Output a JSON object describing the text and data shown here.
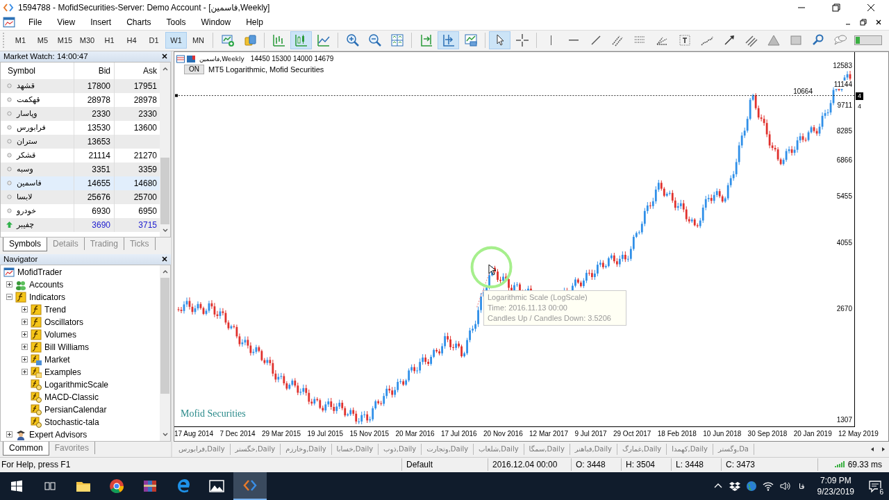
{
  "window": {
    "title": "1594788 - MofidSecurities-Server: Demo Account - [فاسمین,Weekly]"
  },
  "menu": [
    "File",
    "View",
    "Insert",
    "Charts",
    "Tools",
    "Window",
    "Help"
  ],
  "toolbar": {
    "timeframes": [
      {
        "label": "M1",
        "selected": false
      },
      {
        "label": "M5",
        "selected": false
      },
      {
        "label": "M15",
        "selected": false
      },
      {
        "label": "M30",
        "selected": false
      },
      {
        "label": "H1",
        "selected": false
      },
      {
        "label": "H4",
        "selected": false
      },
      {
        "label": "D1",
        "selected": false
      },
      {
        "label": "W1",
        "selected": true
      },
      {
        "label": "MN",
        "selected": false
      }
    ],
    "tools": [
      {
        "kind": "new-chart",
        "selected": false
      },
      {
        "kind": "profiles",
        "selected": false
      },
      {
        "kind": "bars",
        "selected": false
      },
      {
        "kind": "candles",
        "selected": true
      },
      {
        "kind": "line-chart",
        "selected": false
      },
      {
        "kind": "zoom-in",
        "selected": false
      },
      {
        "kind": "zoom-out",
        "selected": false
      },
      {
        "kind": "tile",
        "selected": false
      },
      {
        "kind": "chart-shift",
        "selected": false
      },
      {
        "kind": "autoscroll",
        "selected": true
      },
      {
        "kind": "template",
        "selected": false
      },
      {
        "kind": "cursor",
        "selected": true
      },
      {
        "kind": "crosshair",
        "selected": false
      },
      {
        "kind": "vertical-line",
        "selected": false
      },
      {
        "kind": "horizontal-line",
        "selected": false
      },
      {
        "kind": "trend-line",
        "selected": false
      },
      {
        "kind": "channel",
        "selected": false
      },
      {
        "kind": "grid",
        "selected": false
      },
      {
        "kind": "fan",
        "selected": false
      },
      {
        "kind": "text-box",
        "selected": false
      },
      {
        "kind": "staircase",
        "selected": false
      },
      {
        "kind": "arrow",
        "selected": false
      },
      {
        "kind": "parallel-lines",
        "selected": false
      },
      {
        "kind": "triangle",
        "selected": false
      },
      {
        "kind": "rectangle",
        "selected": false
      },
      {
        "kind": "search",
        "selected": false
      },
      {
        "kind": "chat",
        "selected": false
      }
    ]
  },
  "market_watch": {
    "title": "Market Watch: 14:00:47",
    "columns": [
      "Symbol",
      "Bid",
      "Ask"
    ],
    "rows": [
      {
        "symbol": "قشهد",
        "bid": "17800",
        "ask": "17951",
        "selected": false,
        "kind": "tick"
      },
      {
        "symbol": "قهکمت",
        "bid": "28978",
        "ask": "28978",
        "selected": false,
        "kind": "tick"
      },
      {
        "symbol": "وپاسار",
        "bid": "2330",
        "ask": "2330",
        "selected": false,
        "kind": "tick"
      },
      {
        "symbol": "فرابورس",
        "bid": "13530",
        "ask": "13600",
        "selected": false,
        "kind": "tick"
      },
      {
        "symbol": "ستران",
        "bid": "13653",
        "selected": false,
        "kind": "tick"
      },
      {
        "symbol": "قشکر",
        "bid": "21114",
        "ask": "21270",
        "selected": false,
        "kind": "tick"
      },
      {
        "symbol": "وسبه",
        "bid": "3351",
        "ask": "3359",
        "selected": false,
        "kind": "tick"
      },
      {
        "symbol": "فاسمین",
        "bid": "14655",
        "ask": "14680",
        "selected": true,
        "kind": "tick"
      },
      {
        "symbol": "لابسا",
        "bid": "25676",
        "ask": "25700",
        "selected": false,
        "kind": "tick"
      },
      {
        "symbol": "خودرو",
        "bid": "6930",
        "ask": "6950",
        "selected": false,
        "kind": "tick"
      },
      {
        "symbol": "چفیبر",
        "bid": "3690",
        "ask": "3715",
        "selected": false,
        "kind": "up"
      }
    ],
    "tabs": [
      {
        "label": "Symbols",
        "selected": true
      },
      {
        "label": "Details",
        "selected": false
      },
      {
        "label": "Trading",
        "selected": false
      },
      {
        "label": "Ticks",
        "selected": false
      }
    ]
  },
  "navigator": {
    "title": "Navigator",
    "tree": [
      {
        "label": "MofidTrader",
        "kind": "terminal",
        "children": [
          {
            "label": "Accounts",
            "kind": "accounts",
            "expanded": false
          },
          {
            "label": "Indicators",
            "kind": "folder",
            "expanded": true,
            "children": [
              {
                "label": "Trend",
                "kind": "folder",
                "expanded": false
              },
              {
                "label": "Oscillators",
                "kind": "folder",
                "expanded": false
              },
              {
                "label": "Volumes",
                "kind": "folder",
                "expanded": false
              },
              {
                "label": "Bill Williams",
                "kind": "folder",
                "expanded": false
              },
              {
                "label": "Market",
                "kind": "market",
                "expanded": false
              },
              {
                "label": "Examples",
                "kind": "examples",
                "expanded": false
              },
              {
                "label": "LogarithmicScale",
                "kind": "indicator"
              },
              {
                "label": "MACD-Classic",
                "kind": "indicator"
              },
              {
                "label": "PersianCalendar",
                "kind": "indicator"
              },
              {
                "label": "Stochastic-tala",
                "kind": "indicator"
              }
            ]
          },
          {
            "label": "Expert Advisors",
            "kind": "experts",
            "expanded": false
          }
        ]
      }
    ],
    "tabs": [
      {
        "label": "Common",
        "selected": true
      },
      {
        "label": "Favorites",
        "selected": false
      }
    ]
  },
  "chart": {
    "symbol": "فاسمین,Weekly",
    "ohlc": "14450 15300 14000 14679",
    "indicator_button": "ON",
    "indicator": "MT5 Logarithmic, Mofid Securities",
    "brand": "Mofid Securities",
    "price_line_label": "10664",
    "price_labels": [
      "12583",
      "11144",
      "9711",
      "8285",
      "6866",
      "5455",
      "4055",
      "2670",
      "1307"
    ],
    "price_markers": [
      "4",
      "4"
    ],
    "date_labels": [
      "17 Aug 2014",
      "7 Dec 2014",
      "29 Mar 2015",
      "19 Jul 2015",
      "15 Nov 2015",
      "20 Mar 2016",
      "17 Jul 2016",
      "20 Nov 2016",
      "12 Mar 2017",
      "9 Jul 2017",
      "29 Oct 2017",
      "18 Feb 2018",
      "10 Jun 2018",
      "30 Sep 2018",
      "20 Jan 2019",
      "12 May 2019"
    ],
    "tooltip": [
      "Logarithmic Scale (LogScale)",
      "Time: 2016.11.13 00:00",
      "Candles Up / Candles Down: 3.5206"
    ]
  },
  "chart_tabs": [
    "فرابورس,Daily",
    "خگستر,Daily",
    "وخارزم,Daily",
    "خسابا,Daily",
    "ذوب,Daily",
    "وتجارت,Daily",
    "شلعاب,Daily",
    "سمگا,Daily",
    "فباهنر,Daily",
    "غمارگ,Daily",
    "کهمدا,Daily",
    "وگستر,Da"
  ],
  "status_bar": {
    "help": "For Help, press F1",
    "profile": "Default",
    "time": "2016.12.04 00:00",
    "open": "O: 3448",
    "high": "H: 3504",
    "low": "L: 3448",
    "close": "C: 3473",
    "ping": "69.33 ms"
  },
  "taskbar": {
    "apps": [
      {
        "kind": "folder",
        "active": false
      },
      {
        "kind": "browser",
        "active": false
      },
      {
        "kind": "archive",
        "active": false
      },
      {
        "kind": "edge",
        "active": false
      },
      {
        "kind": "photos",
        "active": false
      },
      {
        "kind": "terminal",
        "active": true
      }
    ],
    "language": "فا",
    "time": "7:09 PM",
    "date": "9/23/2019",
    "notifications": "6"
  }
}
